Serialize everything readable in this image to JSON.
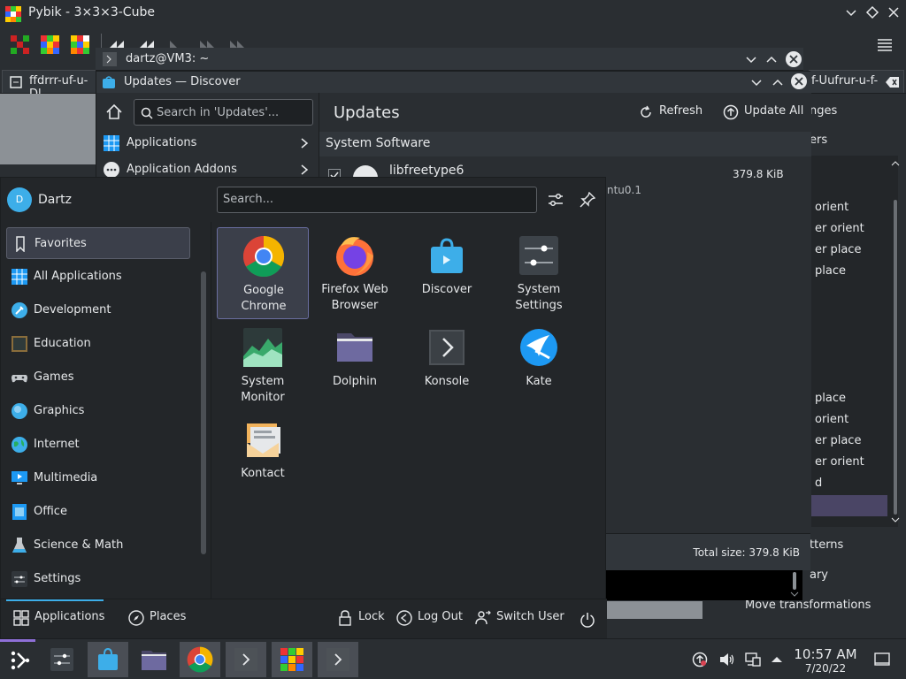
{
  "pybik": {
    "title": "Pybik - 3×3×3-Cube",
    "tabs": [
      "ffdrrr-uf-u-Dl",
      "f-Uufrur-u-f-"
    ],
    "right_items": [
      "nges",
      "ers",
      "orient",
      "er orient",
      "er place",
      "place",
      "place",
      "orient",
      "er place",
      "er orient",
      "d",
      "tterns",
      "ary",
      "Move transformations"
    ]
  },
  "konsole": {
    "title": "dartz@VM3: ~"
  },
  "discover": {
    "title": "Updates — Discover",
    "search_placeholder": "Search in 'Updates'...",
    "sidebar": [
      {
        "label": "Applications"
      },
      {
        "label": "Application Addons"
      }
    ],
    "heading": "Updates",
    "refresh_label": "Refresh",
    "update_all_label": "Update All",
    "section": "System Software",
    "package": {
      "name": "libfreetype6",
      "version_partial": "ntu0.1",
      "size": "379.8 KiB"
    },
    "total_size": "Total size: 379.8 KiB"
  },
  "launcher": {
    "user": {
      "name": "Dartz",
      "initial": "D"
    },
    "search_placeholder": "Search...",
    "categories": [
      {
        "label": "Favorites",
        "icon": "bookmark-icon",
        "selected": true
      },
      {
        "label": "All Applications",
        "icon": "grid-icon"
      },
      {
        "label": "Development",
        "icon": "wrench-icon"
      },
      {
        "label": "Education",
        "icon": "slate-icon"
      },
      {
        "label": "Games",
        "icon": "gamepad-icon"
      },
      {
        "label": "Graphics",
        "icon": "paint-icon"
      },
      {
        "label": "Internet",
        "icon": "globe-icon"
      },
      {
        "label": "Multimedia",
        "icon": "monitor-icon"
      },
      {
        "label": "Office",
        "icon": "document-icon"
      },
      {
        "label": "Science & Math",
        "icon": "flask-icon"
      },
      {
        "label": "Settings",
        "icon": "settings-icon"
      }
    ],
    "apps": [
      {
        "line1": "Google",
        "line2": "Chrome",
        "icon": "chrome-icon",
        "selected": true
      },
      {
        "line1": "Firefox Web",
        "line2": "Browser",
        "icon": "firefox-icon"
      },
      {
        "line1": "Discover",
        "line2": "",
        "icon": "discover-icon"
      },
      {
        "line1": "System",
        "line2": "Settings",
        "icon": "system-settings-icon"
      },
      {
        "line1": "System",
        "line2": "Monitor",
        "icon": "system-monitor-icon"
      },
      {
        "line1": "Dolphin",
        "line2": "",
        "icon": "folder-icon"
      },
      {
        "line1": "Konsole",
        "line2": "",
        "icon": "terminal-icon"
      },
      {
        "line1": "Kate",
        "line2": "",
        "icon": "kate-icon"
      },
      {
        "line1": "Kontact",
        "line2": "",
        "icon": "kontact-icon"
      }
    ],
    "footer": {
      "applications": "Applications",
      "places": "Places",
      "lock": "Lock",
      "logout": "Log Out",
      "switch_user": "Switch User"
    }
  },
  "taskbar": {
    "time": "10:57 AM",
    "date": "7/20/22"
  },
  "colors": {
    "accent": "#3daee9",
    "panel": "#2a2e32",
    "selection": "#3b3f4a"
  }
}
